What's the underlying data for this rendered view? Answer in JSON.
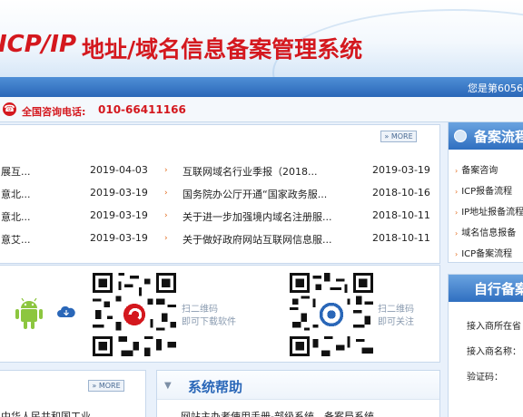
{
  "header": {
    "logo_text": "ICP/IP",
    "title": "地址/域名信息备案管理系统",
    "visitor_label": "您是第6056"
  },
  "hotline": {
    "label": "全国咨询电话:",
    "number": "010-66411166"
  },
  "news": {
    "more_label": "MORE",
    "left_items": [
      {
        "title": "展互...",
        "date": "2019-04-03"
      },
      {
        "title": "意北...",
        "date": "2019-03-19"
      },
      {
        "title": "意北...",
        "date": "2019-03-19"
      },
      {
        "title": "意艾...",
        "date": "2019-03-19"
      }
    ],
    "right_items": [
      {
        "title": "互联网域名行业季报（2018...",
        "date": "2019-03-19"
      },
      {
        "title": "国务院办公厅开通“国家政务服...",
        "date": "2018-10-16"
      },
      {
        "title": "关于进一步加强境内域名注册服...",
        "date": "2018-10-11"
      },
      {
        "title": "关于做好政府网站互联网信息服...",
        "date": "2018-10-11"
      }
    ]
  },
  "app": {
    "qr1_label": [
      "扫二维码",
      "即可下载软件"
    ],
    "qr2_label": [
      "扫二维码",
      "即可关注"
    ]
  },
  "bottom_left": {
    "more_label": "MORE",
    "text": "中华人民共和国工业"
  },
  "help": {
    "title": "系统帮助",
    "item": "网站主办者使用手册-部级系统，备案局系统"
  },
  "flow": {
    "title": "备案流程",
    "items": [
      "备案咨询",
      "ICP报备流程",
      "IP地址报备流程",
      "域名信息报备",
      "ICP备案流程"
    ]
  },
  "self": {
    "title": "自行备案",
    "items": [
      "接入商所在省",
      "接入商名称：",
      "验证码："
    ]
  },
  "colors": {
    "brand_red": "#d4181e",
    "brand_blue": "#2a67b8",
    "bullet_orange": "#e36a1b"
  }
}
